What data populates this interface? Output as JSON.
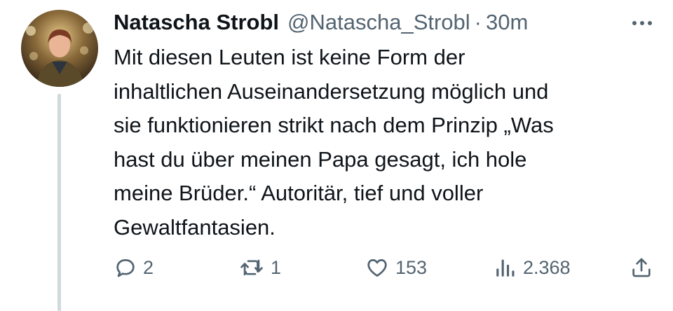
{
  "tweet": {
    "display_name": "Natascha Strobl",
    "handle": "@Natascha_Strobl",
    "separator": "·",
    "time": "30m",
    "text": "Mit diesen Leuten ist keine Form der\ninhaltlichen Auseinandersetzung möglich und\nsie funktionieren strikt nach dem Prinzip „Was\nhast du über meinen Papa gesagt, ich hole\nmeine Brüder.“ Autoritär, tief und voller\nGewaltfantasien.",
    "actions": {
      "reply_count": "2",
      "retweet_count": "1",
      "like_count": "153",
      "views_count": "2.368"
    }
  },
  "icons": {
    "more": "more-horizontal-icon",
    "reply": "reply-icon",
    "retweet": "retweet-icon",
    "like": "heart-icon",
    "views": "analytics-icon",
    "share": "share-icon"
  },
  "colors": {
    "text_primary": "#0f1419",
    "text_secondary": "#536471",
    "thread_line": "#cfd9de",
    "background": "#ffffff"
  }
}
